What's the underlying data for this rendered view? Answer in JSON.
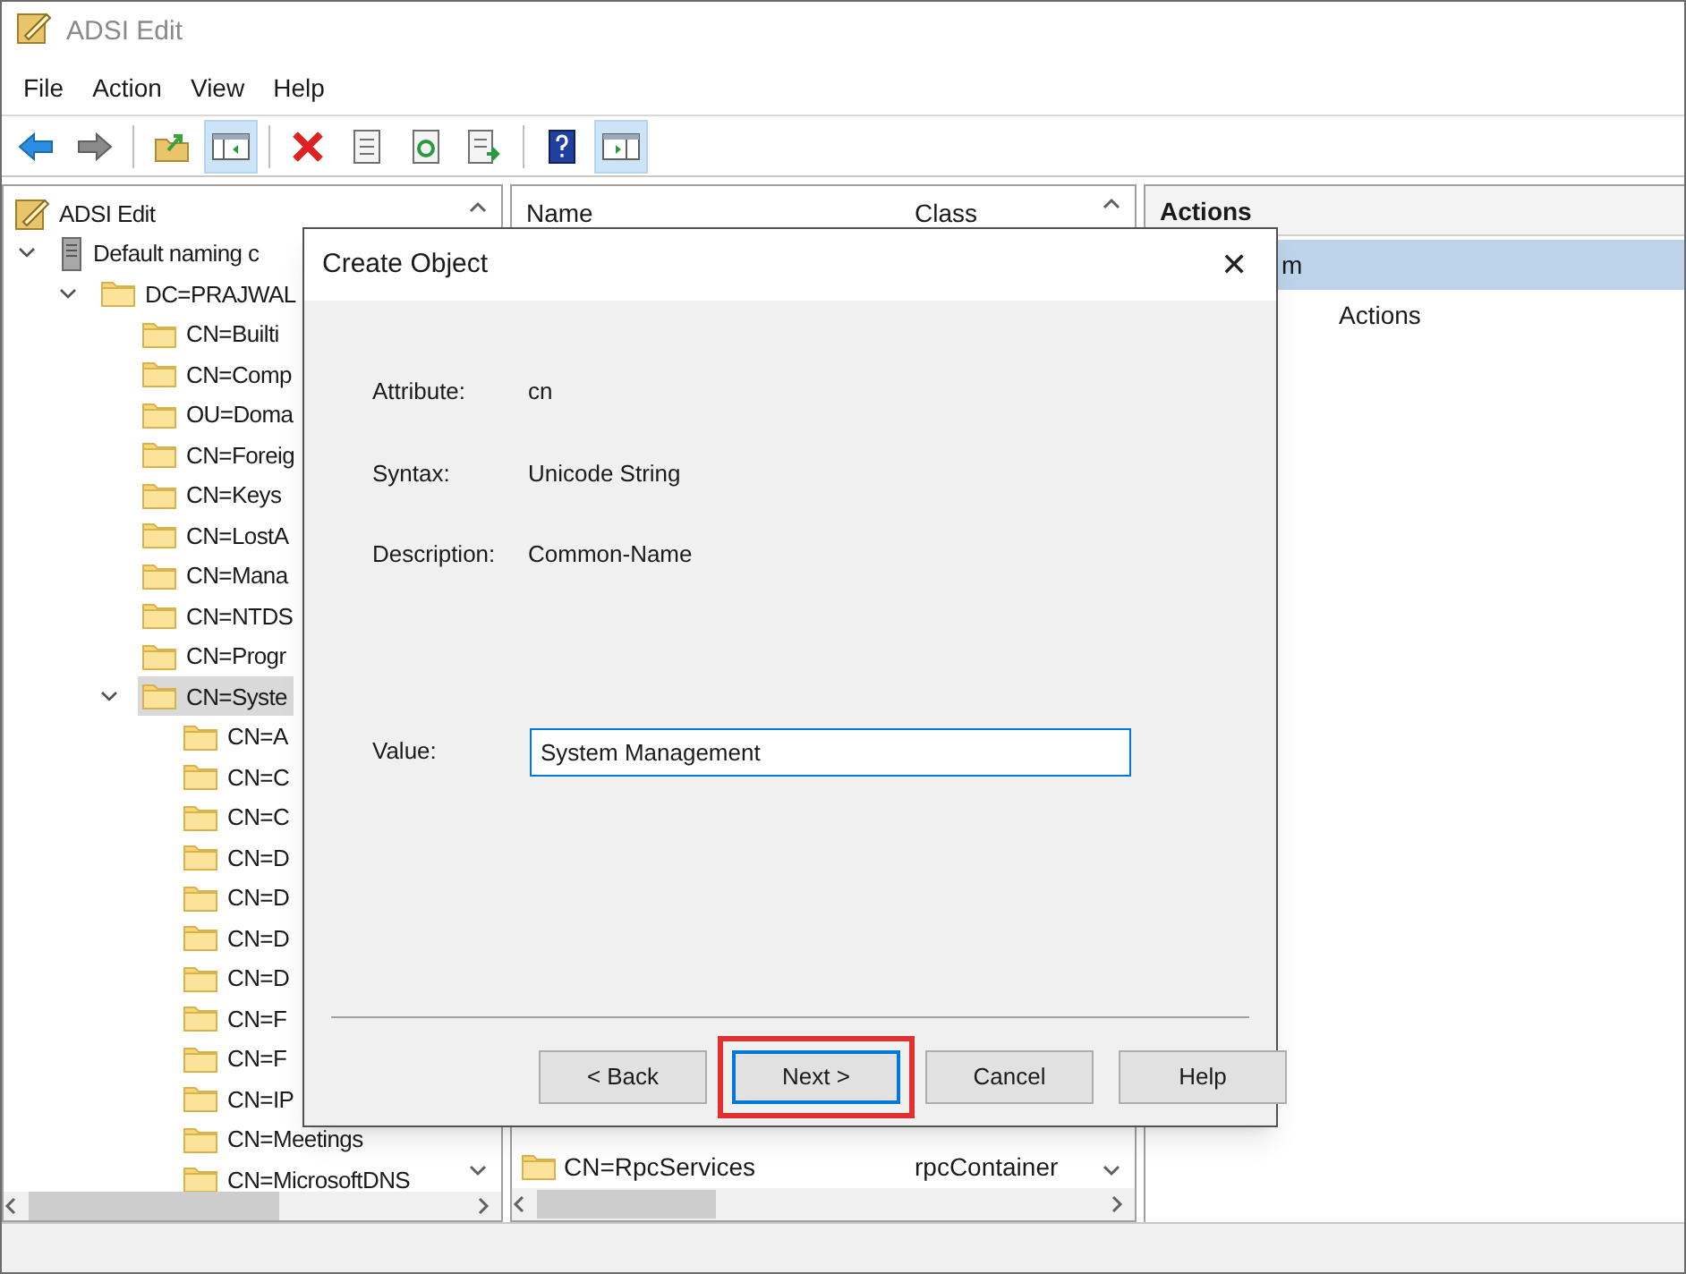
{
  "window": {
    "title": "ADSI Edit"
  },
  "menu": [
    {
      "label": "File"
    },
    {
      "label": "Action"
    },
    {
      "label": "View"
    },
    {
      "label": "Help"
    }
  ],
  "toolbar": [
    {
      "kind": "back",
      "pressed": false
    },
    {
      "kind": "forward",
      "pressed": false
    },
    {
      "kind": "separator"
    },
    {
      "kind": "up",
      "pressed": false
    },
    {
      "kind": "tree",
      "pressed": true
    },
    {
      "kind": "separator"
    },
    {
      "kind": "delete",
      "pressed": false
    },
    {
      "kind": "properties",
      "pressed": false
    },
    {
      "kind": "refresh",
      "pressed": false
    },
    {
      "kind": "export",
      "pressed": false
    },
    {
      "kind": "separator"
    },
    {
      "kind": "help",
      "pressed": false
    },
    {
      "kind": "pane",
      "pressed": true
    }
  ],
  "tree": [
    {
      "label": "ADSI Edit",
      "kind": "root",
      "selected": false,
      "children": [
        {
          "label": "Default naming c",
          "kind": "server",
          "expanded": true,
          "selected": false,
          "children": [
            {
              "label": "DC=PRAJWAL",
              "kind": "folder",
              "expanded": true,
              "selected": false,
              "children": [
                {
                  "label": "CN=Builti",
                  "kind": "folder",
                  "selected": false
                },
                {
                  "label": "CN=Comp",
                  "kind": "folder",
                  "selected": false
                },
                {
                  "label": "OU=Doma",
                  "kind": "folder",
                  "selected": false
                },
                {
                  "label": "CN=Foreig",
                  "kind": "folder",
                  "selected": false
                },
                {
                  "label": "CN=Keys",
                  "kind": "folder",
                  "selected": false
                },
                {
                  "label": "CN=LostA",
                  "kind": "folder",
                  "selected": false
                },
                {
                  "label": "CN=Mana",
                  "kind": "folder",
                  "selected": false
                },
                {
                  "label": "CN=NTDS",
                  "kind": "folder",
                  "selected": false
                },
                {
                  "label": "CN=Progr",
                  "kind": "folder",
                  "selected": false
                },
                {
                  "label": "CN=Syste",
                  "kind": "folder",
                  "expanded": true,
                  "selected": true,
                  "children": [
                    {
                      "label": "CN=A",
                      "kind": "folder",
                      "selected": false
                    },
                    {
                      "label": "CN=C",
                      "kind": "folder",
                      "selected": false
                    },
                    {
                      "label": "CN=C",
                      "kind": "folder",
                      "selected": false
                    },
                    {
                      "label": "CN=D",
                      "kind": "folder",
                      "selected": false
                    },
                    {
                      "label": "CN=D",
                      "kind": "folder",
                      "selected": false
                    },
                    {
                      "label": "CN=D",
                      "kind": "folder",
                      "selected": false
                    },
                    {
                      "label": "CN=D",
                      "kind": "folder",
                      "selected": false
                    },
                    {
                      "label": "CN=F",
                      "kind": "folder",
                      "selected": false
                    },
                    {
                      "label": "CN=F",
                      "kind": "folder",
                      "selected": false
                    },
                    {
                      "label": "CN=IP",
                      "kind": "folder",
                      "selected": false
                    },
                    {
                      "label": "CN=Meetings",
                      "kind": "folder",
                      "selected": false
                    },
                    {
                      "label": "CN=MicrosoftDNS",
                      "kind": "folder",
                      "selected": false
                    }
                  ]
                }
              ]
            }
          ]
        }
      ]
    }
  ],
  "list": {
    "columns": [
      "Name",
      "Class"
    ],
    "rows": [
      {
        "name": "CN=RpcServices",
        "class": "rpcContainer"
      }
    ]
  },
  "actions": {
    "title": "Actions",
    "items": [
      {
        "label": "m",
        "kind": "heading",
        "selected": true
      },
      {
        "label": "Actions",
        "kind": "item",
        "selected": false
      }
    ]
  },
  "dialog": {
    "title": "Create Object",
    "close": "✕",
    "fields": [
      {
        "label": "Attribute:",
        "value": "cn"
      },
      {
        "label": "Syntax:",
        "value": "Unicode String"
      },
      {
        "label": "Description:",
        "value": "Common-Name"
      }
    ],
    "input": {
      "label": "Value:",
      "value": "System Management"
    },
    "buttons": [
      {
        "label": "< Back",
        "focused": false,
        "highlighted": false
      },
      {
        "label": "Next >",
        "focused": true,
        "highlighted": true
      },
      {
        "label": "Cancel",
        "focused": false,
        "highlighted": false
      },
      {
        "label": "Help",
        "focused": false,
        "highlighted": false
      }
    ]
  }
}
